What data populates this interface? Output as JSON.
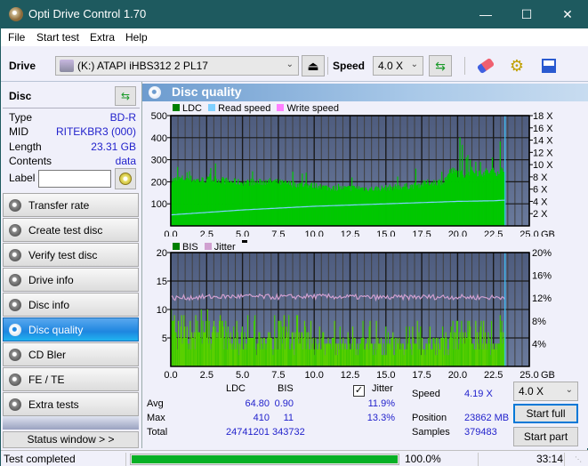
{
  "window": {
    "title": "Opti Drive Control 1.70",
    "controls": {
      "minimize": "—",
      "maximize": "☐",
      "close": "✕"
    }
  },
  "menu": [
    "File",
    "Start test",
    "Extra",
    "Help"
  ],
  "toolbar": {
    "drive_label": "Drive",
    "drive_value": "(K:)  ATAPI iHBS312  2 PL17",
    "speed_label": "Speed",
    "speed_value": "4.0 X",
    "icons": [
      "eject-icon",
      "refresh-icon",
      "erase-icon",
      "settings-icon",
      "save-icon"
    ]
  },
  "disc": {
    "header": "Disc",
    "rows": [
      {
        "key": "Type",
        "value": "BD-R"
      },
      {
        "key": "MID",
        "value": "RITEKBR3 (000)"
      },
      {
        "key": "Length",
        "value": "23.31 GB"
      },
      {
        "key": "Contents",
        "value": "data"
      }
    ],
    "label_key": "Label",
    "label_value": ""
  },
  "nav": [
    {
      "label": "Transfer rate",
      "active": false
    },
    {
      "label": "Create test disc",
      "active": false
    },
    {
      "label": "Verify test disc",
      "active": false
    },
    {
      "label": "Drive info",
      "active": false
    },
    {
      "label": "Disc info",
      "active": false
    },
    {
      "label": "Disc quality",
      "active": true
    },
    {
      "label": "CD Bler",
      "active": false
    },
    {
      "label": "FE / TE",
      "active": false
    },
    {
      "label": "Extra tests",
      "active": false
    }
  ],
  "status_window_button": "Status window > >",
  "panel": {
    "title": "Disc quality"
  },
  "colors": {
    "ldc": "#008000",
    "read_speed": "#7fd0ff",
    "write_speed": "#ff80ff",
    "bis": "#008000",
    "jitter": "#d0a0d0",
    "plot_bg": "#5a6a8c",
    "bar_green": "#00c800",
    "accent": "#0078d7",
    "progress": "#06b025"
  },
  "chart_data": [
    {
      "type": "area",
      "title": "LDC / Read speed",
      "legend": [
        "LDC",
        "Read speed",
        "Write speed"
      ],
      "xlabel": "GB",
      "x_ticks": [
        "0.0",
        "2.5",
        "5.0",
        "7.5",
        "10.0",
        "12.5",
        "15.0",
        "17.5",
        "20.0",
        "22.5",
        "25.0"
      ],
      "xlim": [
        0,
        25
      ],
      "y_left_ticks": [
        "100",
        "200",
        "300",
        "400",
        "500"
      ],
      "ylim_left": [
        0,
        500
      ],
      "y_right_ticks": [
        "2 X",
        "4 X",
        "6 X",
        "8 X",
        "10 X",
        "12 X",
        "14 X",
        "16 X",
        "18 X"
      ],
      "ylim_right": [
        0,
        18
      ],
      "end_marker_x": 23.31,
      "series": [
        {
          "name": "LDC",
          "x": [
            0,
            1,
            2,
            3,
            4,
            5,
            6,
            7,
            8,
            9,
            10,
            11,
            12,
            13,
            14,
            15,
            16,
            17,
            18,
            19,
            19.5,
            20,
            20.5,
            21,
            21.5,
            22,
            22.5,
            23,
            23.31
          ],
          "values": [
            215,
            225,
            215,
            220,
            210,
            205,
            205,
            210,
            200,
            195,
            190,
            180,
            178,
            180,
            175,
            180,
            185,
            190,
            205,
            210,
            260,
            250,
            245,
            260,
            250,
            255,
            255,
            260,
            260
          ]
        },
        {
          "name": "Read speed",
          "x": [
            0,
            2.5,
            5,
            7.5,
            10,
            12.5,
            15,
            17.5,
            20,
            22.5,
            23.31
          ],
          "values": [
            1.8,
            2.2,
            2.6,
            2.9,
            3.2,
            3.4,
            3.6,
            3.8,
            4.0,
            4.1,
            4.2
          ]
        }
      ]
    },
    {
      "type": "area",
      "title": "BIS / Jitter",
      "legend": [
        "BIS",
        "Jitter"
      ],
      "xlabel": "GB",
      "x_ticks": [
        "0.0",
        "2.5",
        "5.0",
        "7.5",
        "10.0",
        "12.5",
        "15.0",
        "17.5",
        "20.0",
        "22.5",
        "25.0"
      ],
      "xlim": [
        0,
        25
      ],
      "y_left_ticks": [
        "5",
        "10",
        "15",
        "20"
      ],
      "ylim_left": [
        0,
        20
      ],
      "y_right_ticks": [
        "4%",
        "8%",
        "12%",
        "16%",
        "20%"
      ],
      "ylim_right": [
        0,
        20
      ],
      "end_marker_x": 23.31,
      "series": [
        {
          "name": "BIS",
          "x": [
            0,
            1,
            2,
            3,
            4,
            5,
            6,
            7,
            8,
            9,
            10,
            11,
            12,
            13,
            14,
            15,
            16,
            17,
            18,
            19,
            20,
            21,
            22,
            23,
            23.31
          ],
          "values": [
            8,
            7,
            7,
            7,
            6,
            6,
            6,
            6,
            6,
            6,
            5,
            5,
            5,
            5,
            5,
            5,
            5,
            5,
            5,
            5,
            6,
            6,
            6,
            6,
            6
          ]
        },
        {
          "name": "Jitter",
          "x": [
            0,
            2.5,
            5,
            7.5,
            10,
            12.5,
            15,
            17.5,
            20,
            22.5,
            23.31
          ],
          "values": [
            12.0,
            12.2,
            12.3,
            12.2,
            12.3,
            12.2,
            12.1,
            12.2,
            12.2,
            12.1,
            12.2
          ]
        }
      ]
    }
  ],
  "stats": {
    "headers": [
      "LDC",
      "BIS"
    ],
    "jitter_label": "Jitter",
    "jitter_checked": true,
    "rows": [
      {
        "label": "Avg",
        "ldc": "64.80",
        "bis": "0.90",
        "jitter": "11.9%"
      },
      {
        "label": "Max",
        "ldc": "410",
        "bis": "11",
        "jitter": "13.3%"
      },
      {
        "label": "Total",
        "ldc": "24741201",
        "bis": "343732",
        "jitter": ""
      }
    ],
    "speed_label": "Speed",
    "speed_value": "4.19 X",
    "position_label": "Position",
    "position_value": "23862 MB",
    "samples_label": "Samples",
    "samples_value": "379483",
    "speed_select": "4.0 X",
    "start_full": "Start full",
    "start_part": "Start part"
  },
  "statusbar": {
    "text": "Test completed",
    "progress": 1.0,
    "progress_text": "100.0%",
    "time": "33:14"
  }
}
